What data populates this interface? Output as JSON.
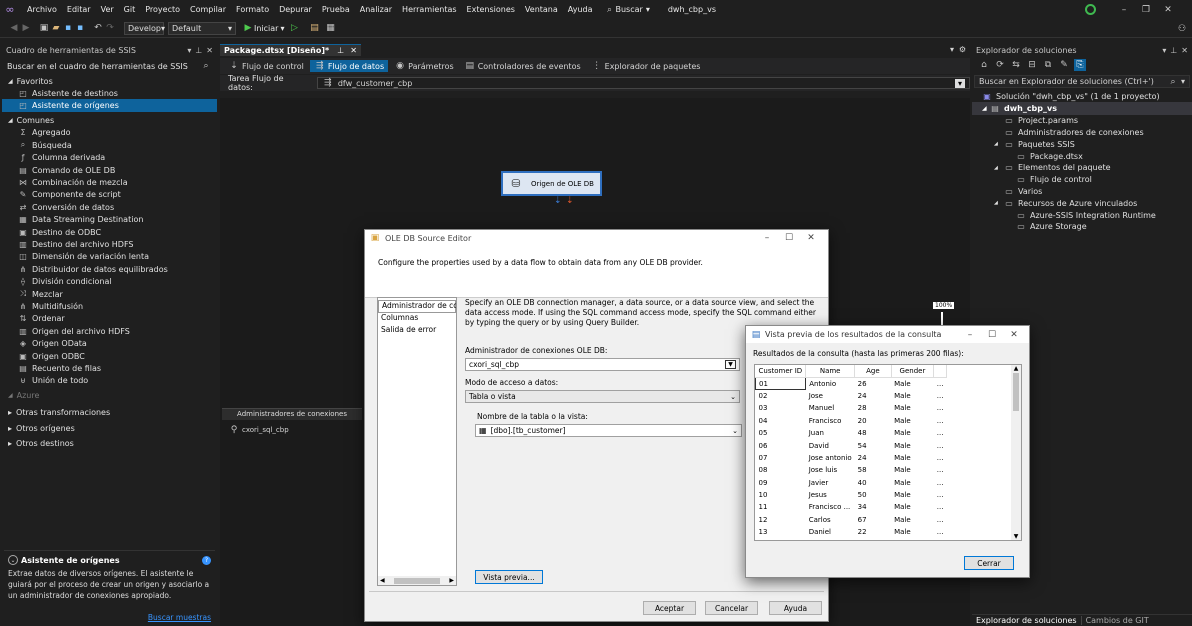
{
  "menu": [
    "Archivo",
    "Editar",
    "Ver",
    "Git",
    "Proyecto",
    "Compilar",
    "Formato",
    "Depurar",
    "Prueba",
    "Analizar",
    "Herramientas",
    "Extensiones",
    "Ventana",
    "Ayuda"
  ],
  "search_label": "Buscar",
  "solution_name": "dwh_cbp_vs",
  "toolbar": {
    "config": "Develop",
    "platform": "Default",
    "start": "Iniciar"
  },
  "toolbox": {
    "title": "Cuadro de herramientas de SSIS",
    "search": "Buscar en el cuadro de herramientas de SSIS",
    "favorites_label": "Favoritos",
    "favorites": [
      {
        "label": "Asistente de destinos",
        "icon": "dest-wizard-icon"
      },
      {
        "label": "Asistente de orígenes",
        "icon": "source-wizard-icon"
      }
    ],
    "common_label": "Comunes",
    "common": [
      {
        "label": "Agregado",
        "icon": "aggregate-icon",
        "g": "Σ"
      },
      {
        "label": "Búsqueda",
        "icon": "lookup-icon",
        "g": "⌕"
      },
      {
        "label": "Columna derivada",
        "icon": "derived-column-icon",
        "g": "ƒ"
      },
      {
        "label": "Comando de OLE DB",
        "icon": "ole-db-command-icon",
        "g": "▤"
      },
      {
        "label": "Combinación de mezcla",
        "icon": "merge-join-icon",
        "g": "⋈"
      },
      {
        "label": "Componente de script",
        "icon": "script-component-icon",
        "g": "✎"
      },
      {
        "label": "Conversión de datos",
        "icon": "data-conversion-icon",
        "g": "⇄"
      },
      {
        "label": "Data Streaming Destination",
        "icon": "streaming-destination-icon",
        "g": "▦"
      },
      {
        "label": "Destino de ODBC",
        "icon": "odbc-destination-icon",
        "g": "▣"
      },
      {
        "label": "Destino del archivo HDFS",
        "icon": "hdfs-destination-icon",
        "g": "▥"
      },
      {
        "label": "Dimensión de variación lenta",
        "icon": "scd-icon",
        "g": "◫"
      },
      {
        "label": "Distribuidor de datos equilibrados",
        "icon": "balanced-distributor-icon",
        "g": "⋔"
      },
      {
        "label": "División condicional",
        "icon": "conditional-split-icon",
        "g": "⟠"
      },
      {
        "label": "Mezclar",
        "icon": "merge-icon",
        "g": "⤨"
      },
      {
        "label": "Multidifusión",
        "icon": "multicast-icon",
        "g": "⋔"
      },
      {
        "label": "Ordenar",
        "icon": "sort-icon",
        "g": "⇅"
      },
      {
        "label": "Origen del archivo HDFS",
        "icon": "hdfs-source-icon",
        "g": "▥"
      },
      {
        "label": "Origen OData",
        "icon": "odata-source-icon",
        "g": "◈"
      },
      {
        "label": "Origen ODBC",
        "icon": "odbc-source-icon",
        "g": "▣"
      },
      {
        "label": "Recuento de filas",
        "icon": "row-count-icon",
        "g": "▤"
      },
      {
        "label": "Unión de todo",
        "icon": "union-all-icon",
        "g": "⊎"
      }
    ],
    "azure_label": "Azure",
    "other_groups": [
      "Otras transformaciones",
      "Otros orígenes",
      "Otros destinos"
    ],
    "info_title": "Asistente de orígenes",
    "info_text": "Extrae datos de diversos orígenes. El asistente le guiará por el proceso de crear un origen y asociarlo a un administrador de conexiones apropiado.",
    "samples_link": "Buscar muestras"
  },
  "doc_tab": "Package.dtsx [Diseño]*",
  "designer_tabs": [
    "Flujo de control",
    "Flujo de datos",
    "Parámetros",
    "Controladores de eventos",
    "Explorador de paquetes"
  ],
  "task_label": "Tarea Flujo de datos:",
  "task_value": "dfw_customer_cbp",
  "component_label": "Origen de OLE DB",
  "conn_managers_title": "Administradores de conexiones",
  "conn_managers": [
    "cxori_sql_cbp"
  ],
  "zoom": "100%",
  "solution_explorer": {
    "title": "Explorador de soluciones",
    "search": "Buscar en Explorador de soluciones (Ctrl+')",
    "solution": "Solución \"dwh_cbp_vs\" (1 de 1 proyecto)",
    "project": "dwh_cbp_vs",
    "items": [
      {
        "label": "Project.params",
        "indent": 1
      },
      {
        "label": "Administradores de conexiones",
        "indent": 1
      },
      {
        "label": "Paquetes SSIS",
        "indent": 1
      },
      {
        "label": "Package.dtsx",
        "indent": 2
      },
      {
        "label": "Elementos del paquete",
        "indent": 1
      },
      {
        "label": "Flujo de control",
        "indent": 2
      },
      {
        "label": "Varios",
        "indent": 1
      },
      {
        "label": "Recursos de Azure vinculados",
        "indent": 1
      },
      {
        "label": "Azure-SSIS Integration Runtime",
        "indent": 2
      },
      {
        "label": "Azure Storage",
        "indent": 2
      }
    ],
    "bottom_tabs": [
      "Explorador de soluciones",
      "Cambios de GIT"
    ]
  },
  "ole_editor": {
    "title": "OLE DB Source Editor",
    "desc": "Configure the properties used by a data flow to obtain data from any OLE DB provider.",
    "nav": [
      "Administrador de cone",
      "Columnas",
      "Salida de error"
    ],
    "help_text": "Specify an OLE DB connection manager, a data source, or a data source view, and select the data access mode. If using the SQL command access mode, specify the SQL command either by typing the query or by using Query Builder.",
    "conn_label": "Administrador de conexiones OLE DB:",
    "conn_value": "cxori_sql_cbp",
    "mode_label": "Modo de acceso a datos:",
    "mode_value": "Tabla o vista",
    "table_label": "Nombre de la tabla o la vista:",
    "table_value": "[dbo].[tb_customer]",
    "preview_btn": "Vista previa...",
    "ok": "Aceptar",
    "cancel": "Cancelar",
    "help": "Ayuda"
  },
  "preview": {
    "title": "Vista previa de los resultados de la consulta",
    "subtitle": "Resultados de la consulta (hasta las primeras 200 filas):",
    "columns": [
      "Customer ID",
      "Name",
      "Age",
      "Gender"
    ],
    "rows": [
      [
        "01",
        "Antonio",
        "26",
        "Male"
      ],
      [
        "02",
        "Jose",
        "24",
        "Male"
      ],
      [
        "03",
        "Manuel",
        "28",
        "Male"
      ],
      [
        "04",
        "Francisco",
        "20",
        "Male"
      ],
      [
        "05",
        "Juan",
        "48",
        "Male"
      ],
      [
        "06",
        "David",
        "54",
        "Male"
      ],
      [
        "07",
        "Jose antonio",
        "24",
        "Male"
      ],
      [
        "08",
        "Jose luis",
        "58",
        "Male"
      ],
      [
        "09",
        "Javier",
        "40",
        "Male"
      ],
      [
        "10",
        "Jesus",
        "50",
        "Male"
      ],
      [
        "11",
        "Francisco ...",
        "34",
        "Male"
      ],
      [
        "12",
        "Carlos",
        "67",
        "Male"
      ],
      [
        "13",
        "Daniel",
        "22",
        "Male"
      ]
    ],
    "more": "...",
    "close": "Cerrar"
  }
}
